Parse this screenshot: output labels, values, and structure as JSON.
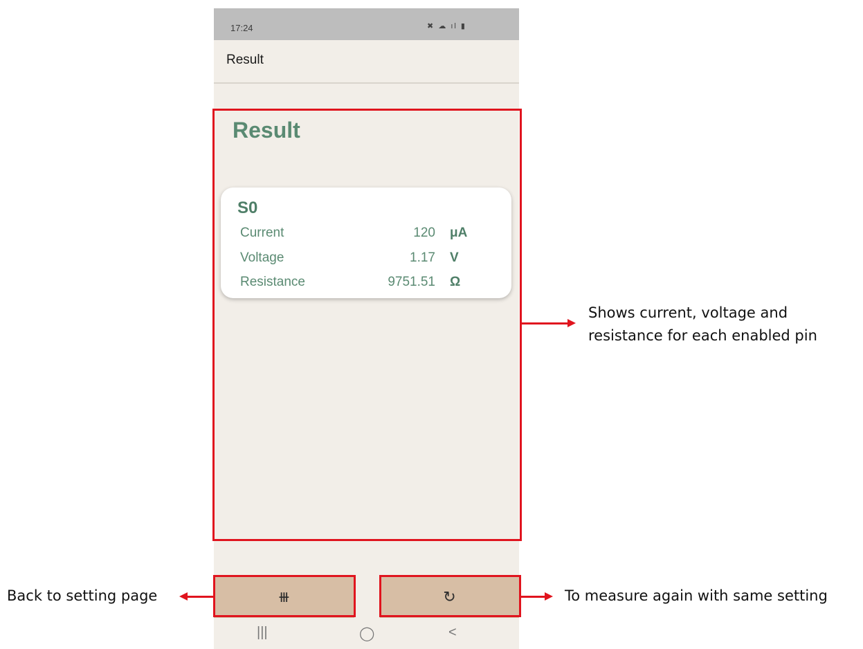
{
  "status_bar": {
    "time": "17:24",
    "icons": "✖ ☁ ıl ▮"
  },
  "app_bar": {
    "title": "Result"
  },
  "content": {
    "heading": "Result",
    "card": {
      "pin": "S0",
      "rows": [
        {
          "label": "Current",
          "value": "120",
          "unit": "μA"
        },
        {
          "label": "Voltage",
          "value": "1.17",
          "unit": "V"
        },
        {
          "label": "Resistance",
          "value": "9751.51",
          "unit": "Ω"
        }
      ]
    }
  },
  "buttons": {
    "back_icon": "⧻",
    "again_icon": "↻"
  },
  "nav": {
    "recents": "|||",
    "home": "◯",
    "back": "<"
  },
  "annotations": {
    "result_note_line1": "Shows current, voltage and",
    "result_note_line2": "resistance for each enabled pin",
    "back_note": "Back to setting page",
    "again_note": "To measure again with same setting"
  },
  "colors": {
    "accent_green": "#5a8a72",
    "button_tan": "#d7bea5",
    "annotation_red": "#e0141e",
    "background": "#f2eee8"
  }
}
